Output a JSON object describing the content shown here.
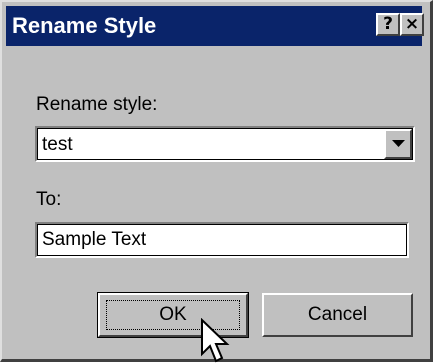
{
  "dialog": {
    "title": "Rename Style",
    "help_button": "?",
    "close_button": "×"
  },
  "rename_style": {
    "label": "Rename style:",
    "selected_value": "test"
  },
  "to": {
    "label": "To:",
    "value": "Sample Text"
  },
  "buttons": {
    "ok_label": "OK",
    "cancel_label": "Cancel"
  },
  "colors": {
    "title_bar": "#0a246a",
    "dialog_face": "#c0c0c0"
  },
  "icons": {
    "dropdown": "chevron-down-icon",
    "cursor": "mouse-pointer-icon"
  }
}
